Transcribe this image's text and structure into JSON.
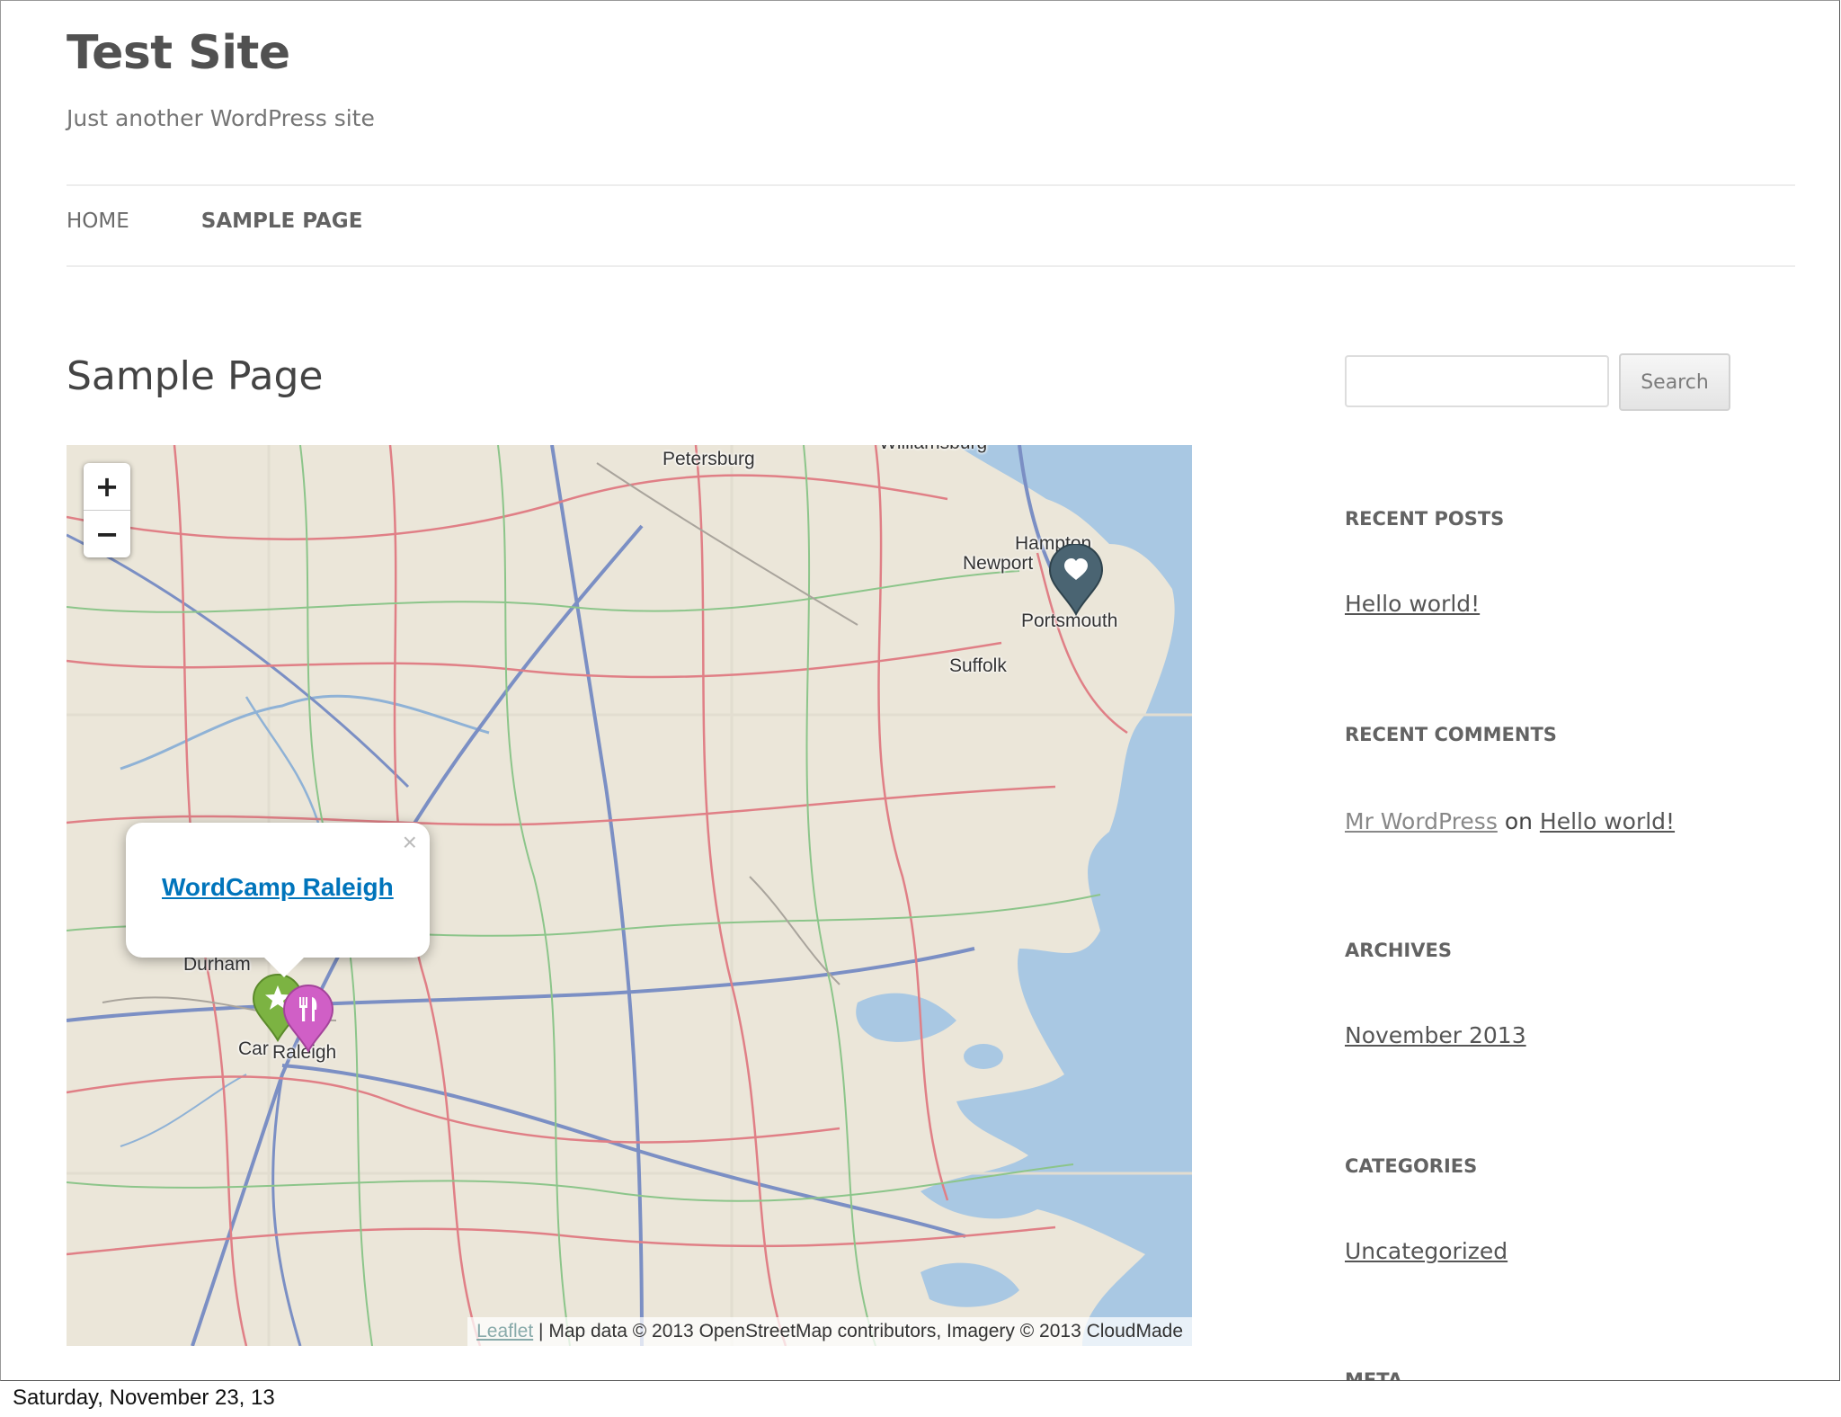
{
  "site": {
    "title": "Test Site",
    "description": "Just another WordPress site"
  },
  "nav": {
    "items": [
      {
        "label": "HOME"
      },
      {
        "label": "SAMPLE PAGE"
      }
    ]
  },
  "page": {
    "title": "Sample Page"
  },
  "map": {
    "zoom_in": "+",
    "zoom_out": "−",
    "cities": [
      "Petersburg",
      "Williamsburg",
      "Hampton",
      "Newport",
      "Portsmouth",
      "Suffolk",
      "Durham",
      "Car",
      "Raleigh"
    ],
    "popup": {
      "link": "WordCamp Raleigh",
      "close": "×"
    },
    "markers": [
      {
        "icon": "heart-icon",
        "color": "#4a6472"
      },
      {
        "icon": "star-icon",
        "color": "#7cb342"
      },
      {
        "icon": "fork-knife-icon",
        "color": "#d05fc6"
      }
    ],
    "attribution": {
      "leaflet": "Leaflet",
      "text": "| Map data © 2013 OpenStreetMap contributors, Imagery © 2013 CloudMade"
    }
  },
  "sidebar": {
    "search": {
      "placeholder": "",
      "button": "Search"
    },
    "recent_posts": {
      "title": "RECENT POSTS",
      "items": [
        "Hello world!"
      ]
    },
    "recent_comments": {
      "title": "RECENT COMMENTS",
      "author": "Mr WordPress",
      "on": "on",
      "post": "Hello world!"
    },
    "archives": {
      "title": "ARCHIVES",
      "items": [
        "November 2013"
      ]
    },
    "categories": {
      "title": "CATEGORIES",
      "items": [
        "Uncategorized"
      ]
    },
    "meta": {
      "title": "META"
    }
  },
  "footer": {
    "date": "Saturday, November 23, 13"
  }
}
